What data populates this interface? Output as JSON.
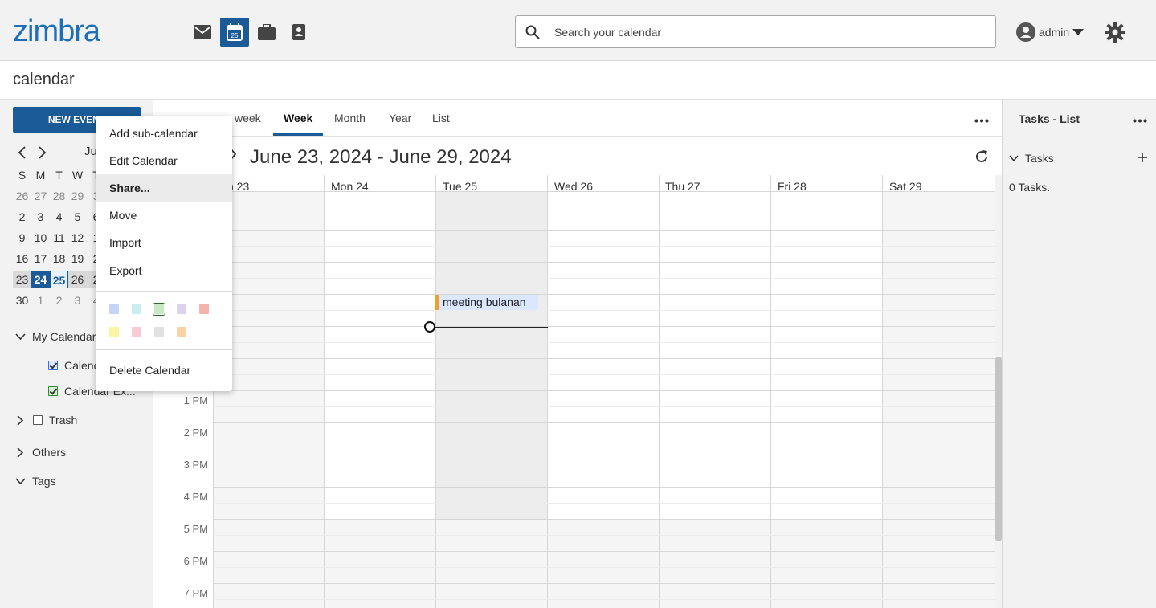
{
  "header": {
    "logo": "zimbra",
    "apps": [
      {
        "name": "mail-icon",
        "active": false
      },
      {
        "name": "calendar-icon",
        "active": true,
        "badge": "25"
      },
      {
        "name": "briefcase-icon",
        "active": false
      },
      {
        "name": "contacts-icon",
        "active": false
      }
    ],
    "search_placeholder": "Search your calendar",
    "user": "admin"
  },
  "app_title": "calendar",
  "left": {
    "new_event": "NEW EVENT",
    "mini_month": "Ju",
    "weekdays": [
      "S",
      "M",
      "T",
      "W",
      "T"
    ],
    "weeks": [
      [
        "26",
        "27",
        "28",
        "29",
        "3"
      ],
      [
        "2",
        "3",
        "4",
        "5",
        "6"
      ],
      [
        "9",
        "10",
        "11",
        "12",
        "1"
      ],
      [
        "16",
        "17",
        "18",
        "19",
        "2"
      ],
      [
        "23",
        "24",
        "25",
        "26",
        "2"
      ],
      [
        "30",
        "1",
        "2",
        "3",
        "4"
      ]
    ],
    "my_calendars": "My Calendar",
    "calendar_1": "Calenc",
    "calendar_2": "Calendar Ex...",
    "trash": "Trash",
    "others": "Others",
    "tags": "Tags"
  },
  "main": {
    "tabs": [
      "week",
      "Week",
      "Month",
      "Year",
      "List"
    ],
    "range_title": "June 23, 2024 - June 29, 2024",
    "days": [
      "n 23",
      "Mon 24",
      "Tue 25",
      "Wed 26",
      "Thu 27",
      "Fri 28",
      "Sat 29"
    ],
    "hours": [
      "1 PM",
      "2 PM",
      "3 PM",
      "4 PM",
      "5 PM",
      "6 PM",
      "7 PM"
    ],
    "event_title": "meeting bulanan"
  },
  "right": {
    "title": "Tasks - List",
    "section": "Tasks",
    "count": "0 Tasks."
  },
  "context_menu": {
    "items": [
      "Add sub-calendar",
      "Edit Calendar",
      "Share...",
      "Move",
      "Import",
      "Export"
    ],
    "delete": "Delete Calendar",
    "swatches_row1": [
      "#c5d4f4",
      "#c9eef0",
      "#c9e8c4",
      "#ddd3ef",
      "#f3b4ac"
    ],
    "swatches_row2": [
      "#fbf4a3",
      "#f6ccd3",
      "#e1e1e1",
      "#f8d3a1"
    ]
  },
  "colors": {
    "brand": "#1a5a96",
    "logo": "#1e6fb8",
    "event_bg": "#dbe6ff",
    "event_border": "#f0a030"
  }
}
